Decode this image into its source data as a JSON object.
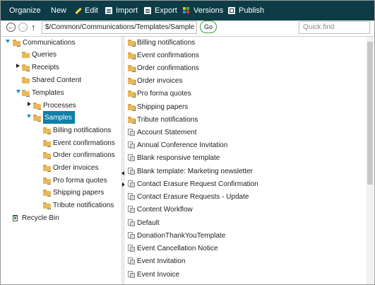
{
  "toolbar": {
    "organize": "Organize",
    "new": "New",
    "edit": "Edit",
    "import": "Import",
    "export": "Export",
    "versions": "Versions",
    "publish": "Publish",
    "accent_color": "#0d3c47"
  },
  "address": {
    "path": "$/Common/Communications/Templates/Sample",
    "go_label": "Go",
    "quick_find_placeholder": "Quick find"
  },
  "tree": {
    "root": "Communications",
    "queries": "Queries",
    "receipts": "Receipts",
    "shared": "Shared Content",
    "templates": "Templates",
    "processes": "Processes",
    "samples": "Samples",
    "sample_children": [
      "Billing notifications",
      "Event confirmations",
      "Order confirmations",
      "Order invoices",
      "Pro forma quotes",
      "Shipping papers",
      "Tribute notifications"
    ],
    "recycle": "Recycle Bin"
  },
  "list": {
    "folders": [
      "Billing notifications",
      "Event confirmations",
      "Order confirmations",
      "Order invoices",
      "Pro forma quotes",
      "Shipping papers",
      "Tribute notifications"
    ],
    "templates": [
      "Account Statement",
      "Annual Conference Invitation",
      "Blank responsive template",
      "Blank template: Marketing newsletter",
      "Contact Erasure Request Confirmation",
      "Contact Erasure Requests - Update",
      "Content Workflow",
      "Default",
      "DonationThankYouTemplate",
      "Event Cancellation Notice",
      "Event Invitation",
      "Event Invoice"
    ]
  }
}
